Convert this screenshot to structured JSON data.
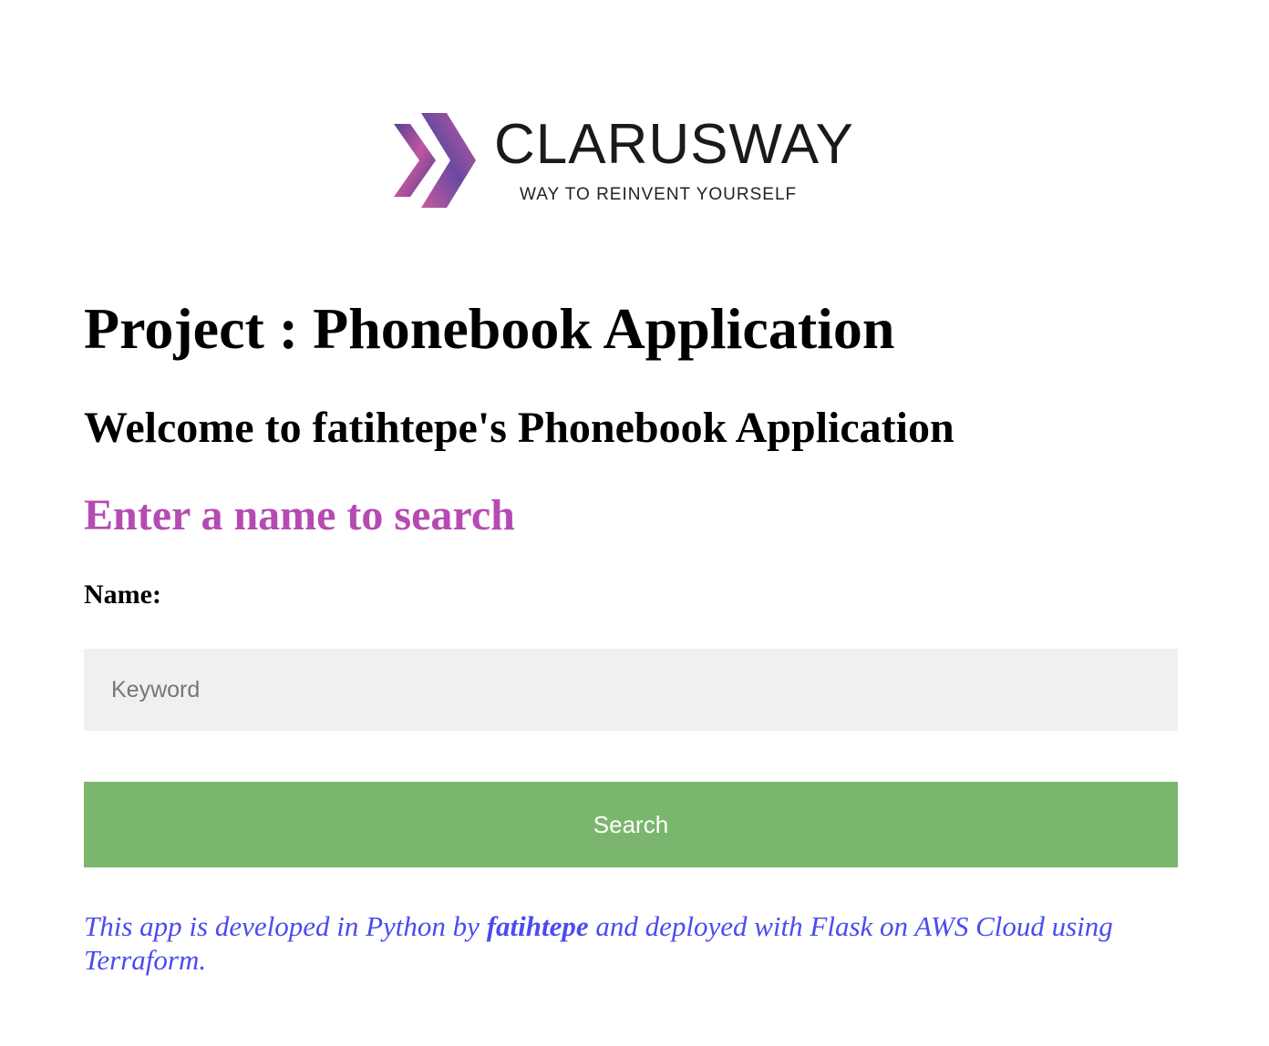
{
  "logo": {
    "brand": "CLARUSWAY",
    "tagline": "WAY TO REINVENT YOURSELF",
    "colors": {
      "chevron_dark": "#4a3c8c",
      "chevron_light": "#c85aa0"
    }
  },
  "header": {
    "title": "Project : Phonebook Application",
    "welcome": "Welcome to fatihtepe's Phonebook Application"
  },
  "search": {
    "heading": "Enter a name to search",
    "heading_color": "#b64ab3",
    "label": "Name:",
    "placeholder": "Keyword",
    "value": "",
    "button_label": "Search",
    "button_color": "#7ab66d"
  },
  "footer": {
    "prefix": "This app is developed in Python by ",
    "author": "fatihtepe",
    "suffix": " and deployed with Flask on AWS Cloud using Terraform.",
    "color": "#4b4bf0"
  }
}
